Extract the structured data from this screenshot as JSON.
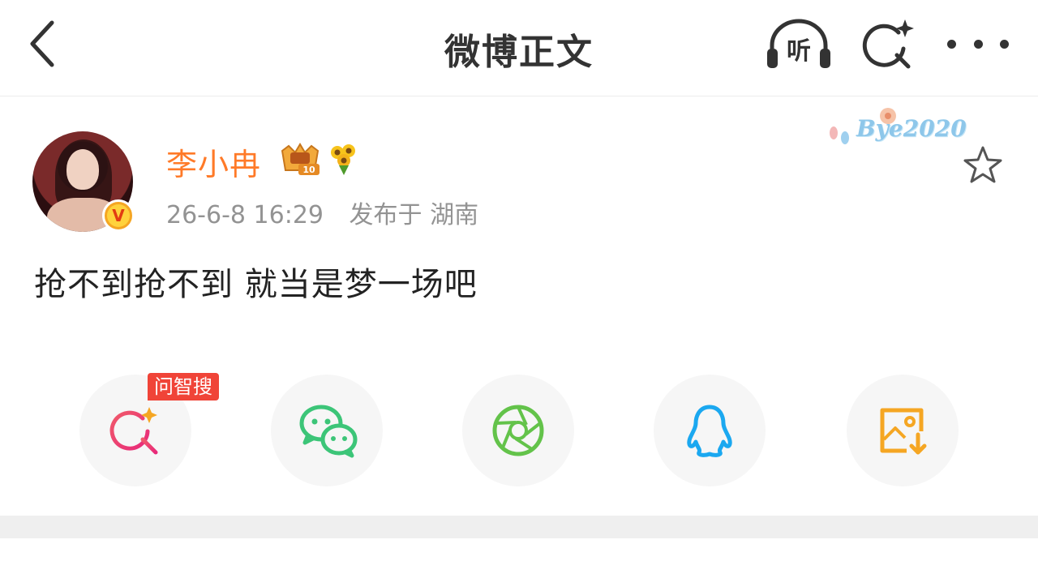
{
  "nav": {
    "title": "微博正文",
    "listen_label": "听"
  },
  "post": {
    "username": "李小冉",
    "vip_level": "10",
    "verified_mark": "V",
    "time": "26-6-8 16:29",
    "location": "发布于 湖南",
    "decoration_text": "Bye2020",
    "text": "抢不到抢不到 就当是梦一场吧"
  },
  "share": {
    "ask_tag": "问智搜",
    "items": [
      "search-ai-icon",
      "wechat-icon",
      "moments-icon",
      "qq-icon",
      "save-image-icon"
    ]
  },
  "colors": {
    "username": "#ff7a28",
    "meta": "#939393",
    "ask_tag": "#f04438",
    "wechat": "#3cc578",
    "moments": "#63c34a",
    "qq": "#1ba8f0",
    "save_image": "#f5a623"
  }
}
